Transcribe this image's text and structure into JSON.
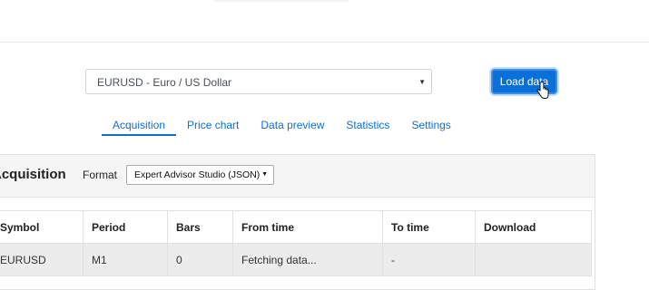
{
  "symbol_select": {
    "value": "EURUSD - Euro / US Dollar"
  },
  "load_button": {
    "label": "Load data"
  },
  "tabs": [
    {
      "label": "Acquisition",
      "active": true
    },
    {
      "label": "Price chart",
      "active": false
    },
    {
      "label": "Data preview",
      "active": false
    },
    {
      "label": "Statistics",
      "active": false
    },
    {
      "label": "Settings",
      "active": false
    }
  ],
  "panel": {
    "title": "Acquisition",
    "format_label": "Format",
    "format_value": "Expert Advisor Studio (JSON)"
  },
  "table": {
    "headers": [
      "Symbol",
      "Period",
      "Bars",
      "From time",
      "To time",
      "Download"
    ],
    "rows": [
      [
        "EURUSD",
        "M1",
        "0",
        "Fetching data...",
        "-",
        ""
      ]
    ]
  },
  "colors": {
    "accent": "#0b6fd8",
    "panel_header_bg": "#f5f5f5",
    "row_bg": "#ececec"
  }
}
